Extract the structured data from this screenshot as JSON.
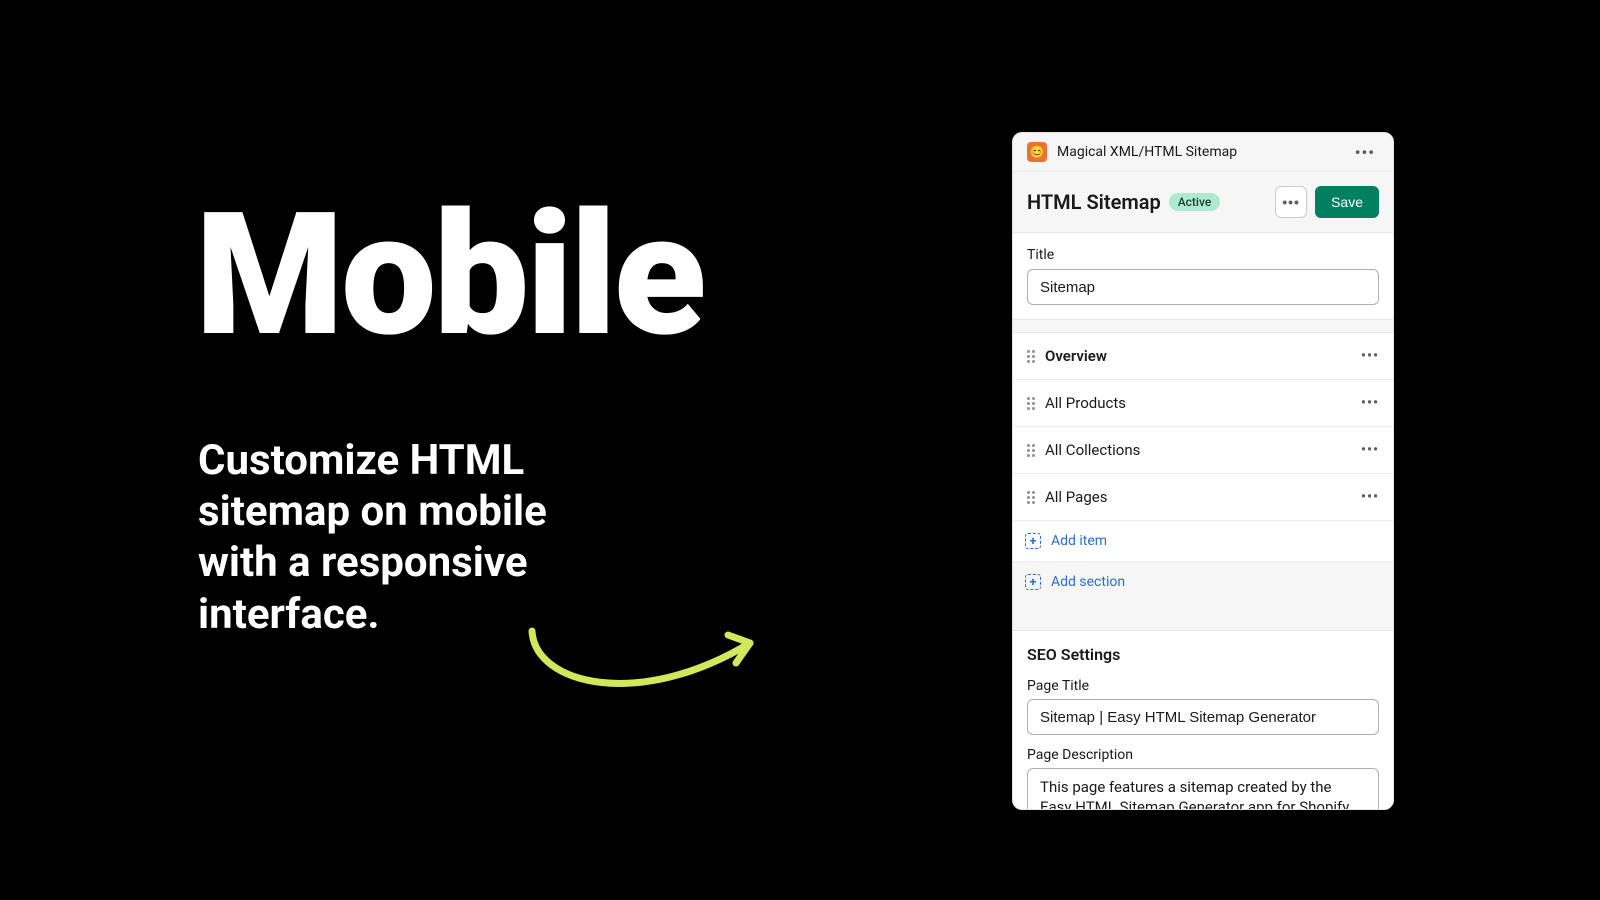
{
  "hero": {
    "title": "Mobile",
    "subtitle": "Customize HTML sitemap on mobile with a responsive interface."
  },
  "app": {
    "titlebar": {
      "title": "Magical XML/HTML Sitemap",
      "icon_emoji": "😊"
    },
    "header": {
      "title": "HTML Sitemap",
      "badge": "Active",
      "save_label": "Save"
    },
    "title_field": {
      "label": "Title",
      "value": "Sitemap"
    },
    "sections": [
      {
        "label": "Overview",
        "bold": true
      },
      {
        "label": "All Products",
        "bold": false
      },
      {
        "label": "All Collections",
        "bold": false
      },
      {
        "label": "All Pages",
        "bold": false
      }
    ],
    "add_item_label": "Add item",
    "add_section_label": "Add section",
    "seo": {
      "heading": "SEO Settings",
      "page_title_label": "Page Title",
      "page_title_value": "Sitemap | Easy HTML Sitemap Generator",
      "page_desc_label": "Page Description",
      "page_desc_value": "This page features a sitemap created by the Easy HTML Sitemap Generator app for Shopify."
    }
  }
}
